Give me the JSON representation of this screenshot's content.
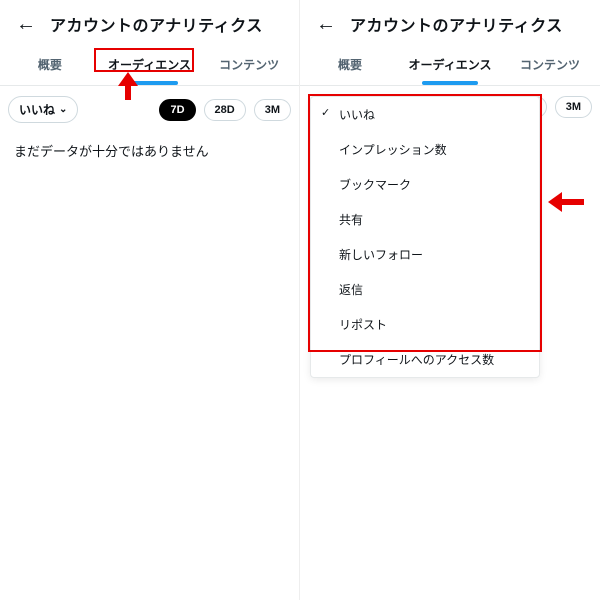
{
  "header": {
    "title": "アカウントのアナリティクス"
  },
  "tabs": {
    "overview": "概要",
    "audience": "オーディエンス",
    "content": "コンテンツ"
  },
  "filter": {
    "selected_label": "いいね"
  },
  "range": {
    "d7": "7D",
    "d28": "28D",
    "m3": "3M"
  },
  "message": "まだデータが十分ではありません",
  "menu": {
    "items": [
      "いいね",
      "インプレッション数",
      "ブックマーク",
      "共有",
      "新しいフォロー",
      "返信",
      "リポスト",
      "プロフィールへのアクセス数"
    ]
  }
}
